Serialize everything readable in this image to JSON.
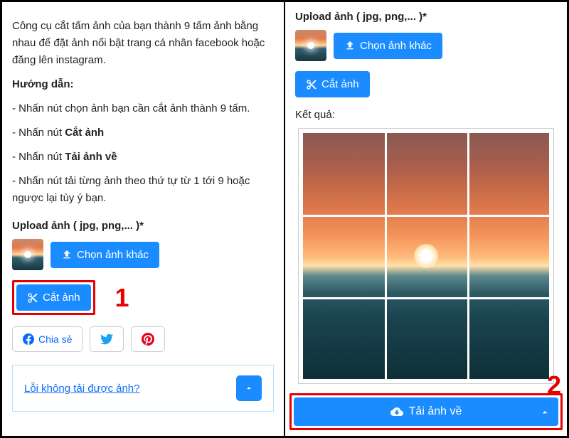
{
  "left": {
    "description": "Công cụ cắt tấm ảnh của bạn thành 9 tấm ảnh bằng nhau để đặt ảnh nổi bật trang cá nhân facebook hoặc đăng lên instagram.",
    "guide_title": "Hướng dẫn:",
    "steps": [
      "- Nhấn nút chọn ảnh bạn cần cắt ảnh thành 9 tấm.",
      "- Nhấn nút ",
      "- Nhấn nút ",
      "- Nhấn nút tải từng ảnh theo thứ tự từ 1 tới 9 hoặc ngược lại tùy ý bạn."
    ],
    "step_bold_1": "Cắt ảnh",
    "step_bold_2": "Tải ảnh về",
    "upload_label": "Upload ảnh ( jpg, png,... )*",
    "choose_btn": "Chọn ảnh khác",
    "cut_btn": "Cắt ảnh",
    "step_num": "1",
    "share": "Chia sẻ",
    "faq": "Lỗi không tải được ảnh?"
  },
  "right": {
    "upload_label": "Upload ảnh ( jpg, png,... )*",
    "choose_btn": "Chọn ảnh khác",
    "cut_btn": "Cắt ảnh",
    "result_label": "Kết quả:",
    "download_btn": "Tải ảnh về",
    "step_num": "2"
  }
}
